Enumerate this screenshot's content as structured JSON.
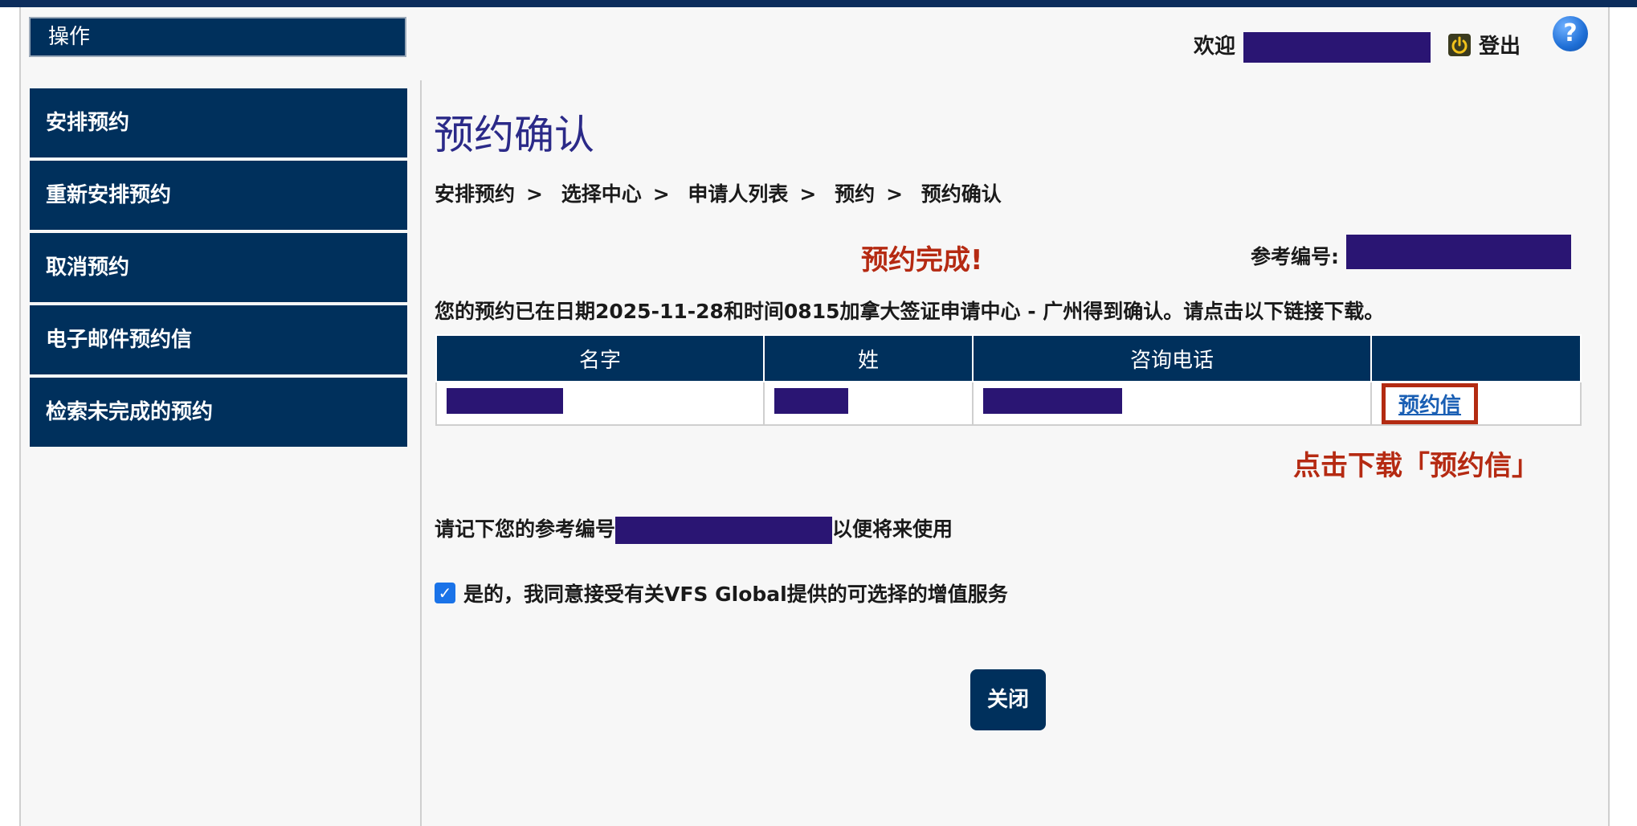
{
  "header": {
    "ops_label": "操作",
    "welcome_label": "欢迎",
    "logout_label": "登出",
    "help_label": "?"
  },
  "sidebar": {
    "items": [
      {
        "label": "安排预约"
      },
      {
        "label": "重新安排预约"
      },
      {
        "label": "取消预约"
      },
      {
        "label": "电子邮件预约信"
      },
      {
        "label": "检索未完成的预约"
      }
    ]
  },
  "main": {
    "title": "预约确认",
    "breadcrumb": [
      "安排预约",
      "选择中心",
      "申请人列表",
      "预约",
      "预约确认"
    ],
    "breadcrumb_sep": ">",
    "done_text": "预约完成!",
    "ref_label": "参考编号:",
    "confirmation": "您的预约已在日期2025-11-28和时间0815加拿大签证申请中心 - 广州得到确认。请点击以下链接下载。",
    "table": {
      "headers": [
        "名字",
        "姓",
        "咨询电话",
        ""
      ],
      "letter_link": "预约信"
    },
    "download_hint": "点击下载「预约信」",
    "remember_prefix": "请记下您的参考编号",
    "remember_suffix": "以便将来使用",
    "consent": "是的，我同意接受有关VFS Global提供的可选择的增值服务",
    "consent_checked": true,
    "close_label": "关闭"
  },
  "colors": {
    "navy": "#00305c",
    "redaction": "#2a1573",
    "accent_red": "#b52a12",
    "title": "#2b2a88",
    "link": "#1a5fb4"
  },
  "icons": [
    "power-icon",
    "help-icon",
    "checkbox-checked-icon"
  ]
}
